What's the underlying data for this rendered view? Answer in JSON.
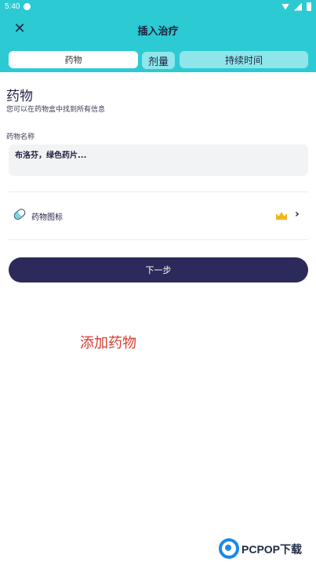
{
  "status_bar": {
    "time": "5:40"
  },
  "header": {
    "close_icon": "close-icon",
    "title": "插入治疗"
  },
  "tabs": [
    {
      "label": "药物",
      "selected": true
    },
    {
      "label": "剂量",
      "selected": false
    },
    {
      "label": "持续时间",
      "selected": false
    }
  ],
  "section": {
    "title": "药物",
    "subtitle": "您可以在药物盒中找到所有信息"
  },
  "medication_name": {
    "label": "药物名称",
    "placeholder": "布洛芬，绿色药片..."
  },
  "medication_icon_row": {
    "label": "药物图标",
    "icons": [
      "pill-icon",
      "crown-icon",
      "chevron-right-icon"
    ]
  },
  "next_button": {
    "label": "下一步"
  },
  "caption": "添加药物",
  "watermark": {
    "text": "PCPOP下载"
  },
  "colors": {
    "header_bg": "#2ccad3",
    "tab_inactive_bg": "#8ee6ea",
    "primary_button": "#2c2a5a",
    "caption_red": "#d63c2e",
    "crown_gold": "#f2b51c"
  }
}
